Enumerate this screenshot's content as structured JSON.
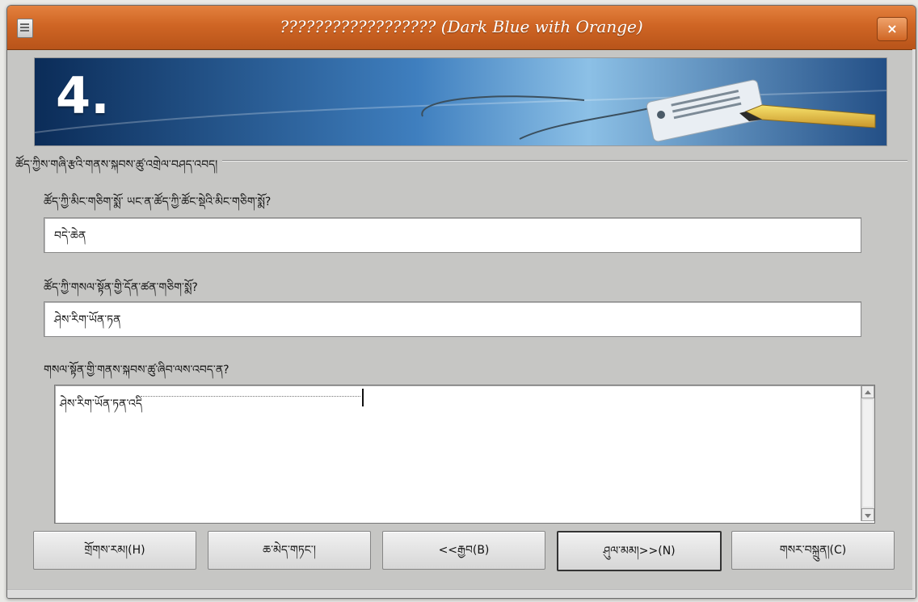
{
  "window": {
    "title": "?????????????????? (Dark Blue with Orange)",
    "icon": "document-icon",
    "close_icon": "×"
  },
  "banner": {
    "step_number": "4.",
    "colors": {
      "dark": "#0a2d5a",
      "light": "#7fb5df"
    }
  },
  "section": {
    "title": "ཚོད་ཀྱིས་གཞི་རྩའི་གནས་སྐབས་ཚུ་འགྲེལ་བཤད་འབད།"
  },
  "fields": [
    {
      "label": "ཚོད་ཀྱི་མིང་གཅིག་སྨོ་ ཡང་ན་ཚོད་ཀྱི་ཚོང་སྡེའི་མིང་གཅིག་སྨོ?",
      "value": "བདེ་ཆེན"
    },
    {
      "label": "ཚོད་ཀྱི་གསལ་སྟོན་གྱི་དོན་ཚན་གཅིག་སྨོ?",
      "value": "ཤེས་རིག་ཡོན་ཏན"
    }
  ],
  "description": {
    "label": "གསལ་སྟོན་གྱི་གནས་སྐབས་ཚུ་ཞིབ་ལས་འབད་ན?",
    "value": "ཤེས་རིག་ཡོན་ཏན་འདི"
  },
  "buttons": {
    "help": "གྲོགས་རམ།(H)",
    "cancel": "ཆ་མེད་གཏང་།",
    "back": "<<རྒྱབ(B)",
    "next": "ཤུལ་མམ།>>(N)",
    "create": "གསར་བསྐྲུན།(C)"
  }
}
